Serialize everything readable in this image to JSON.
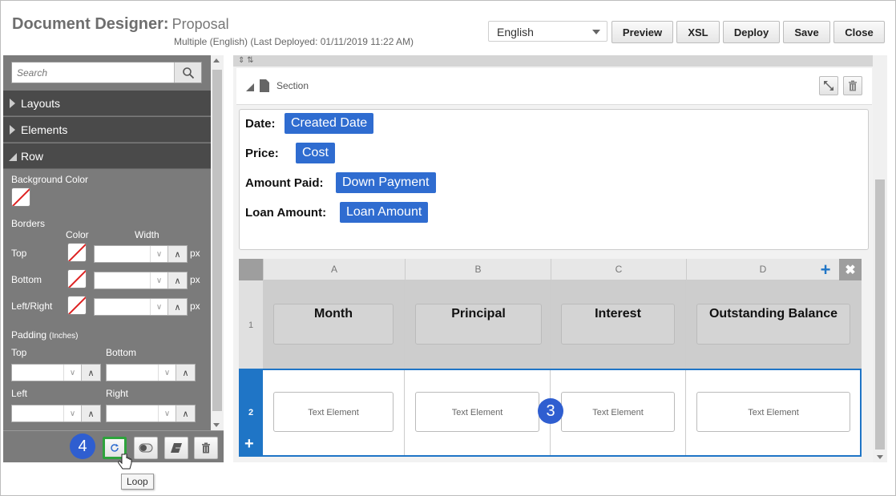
{
  "header": {
    "title": "Document Designer:",
    "subtitle": "Proposal",
    "meta": "Multiple (English)  (Last Deployed: 01/11/2019 11:22 AM)",
    "language": "English",
    "buttons": {
      "preview": "Preview",
      "xsl": "XSL",
      "deploy": "Deploy",
      "save": "Save",
      "close": "Close"
    }
  },
  "sidebar": {
    "search_placeholder": "Search",
    "accordion": {
      "layouts": "Layouts",
      "elements": "Elements",
      "row": "Row"
    },
    "row_props": {
      "background_color": "Background Color",
      "borders": "Borders",
      "color": "Color",
      "width": "Width",
      "top": "Top",
      "bottom": "Bottom",
      "left_right": "Left/Right",
      "px": "px",
      "padding": "Padding",
      "padding_unit": "(Inches)",
      "pad_top": "Top",
      "pad_bottom": "Bottom",
      "pad_left": "Left",
      "pad_right": "Right"
    },
    "tooltip": "Loop"
  },
  "callouts": {
    "step3": "3",
    "step4": "4"
  },
  "section": {
    "label": "Section"
  },
  "fields": [
    {
      "label": "Date:",
      "value": "Created Date"
    },
    {
      "label": "Price:",
      "value": "Cost"
    },
    {
      "label": "Amount Paid:",
      "value": "Down Payment"
    },
    {
      "label": "Loan Amount:",
      "value": "Loan Amount"
    }
  ],
  "table": {
    "columns": [
      "A",
      "B",
      "C",
      "D"
    ],
    "rows": [
      "1",
      "2"
    ],
    "headers": [
      "Month",
      "Principal",
      "Interest",
      "Outstanding Balance"
    ],
    "cells": [
      "Text Element",
      "Text Element",
      "Text Element",
      "Text Element"
    ]
  },
  "colors": {
    "accent": "#2f6cd0",
    "selection": "#1f75c6",
    "panel": "#7b7b7b",
    "callout": "#2f5ed0",
    "loop_highlight": "#2ea33c"
  }
}
